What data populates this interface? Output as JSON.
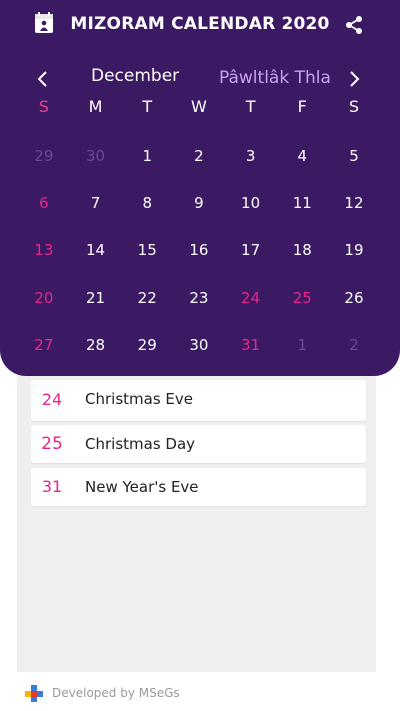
{
  "app": {
    "title": "MIZORAM CALENDAR 2020",
    "logo_icon": "calendar-figure-icon",
    "share_icon": "share-icon"
  },
  "calendar": {
    "month": "December",
    "month_mizo": "Pâwltlâk Thla",
    "weekdays": [
      "S",
      "M",
      "T",
      "W",
      "T",
      "F",
      "S"
    ],
    "weeks": [
      [
        {
          "d": "29",
          "s": "muted"
        },
        {
          "d": "30",
          "s": "muted"
        },
        {
          "d": "1",
          "s": "normal"
        },
        {
          "d": "2",
          "s": "normal"
        },
        {
          "d": "3",
          "s": "normal"
        },
        {
          "d": "4",
          "s": "normal"
        },
        {
          "d": "5",
          "s": "normal"
        }
      ],
      [
        {
          "d": "6",
          "s": "holiday"
        },
        {
          "d": "7",
          "s": "normal"
        },
        {
          "d": "8",
          "s": "normal"
        },
        {
          "d": "9",
          "s": "normal"
        },
        {
          "d": "10",
          "s": "normal"
        },
        {
          "d": "11",
          "s": "normal"
        },
        {
          "d": "12",
          "s": "normal"
        }
      ],
      [
        {
          "d": "13",
          "s": "holiday"
        },
        {
          "d": "14",
          "s": "normal"
        },
        {
          "d": "15",
          "s": "normal"
        },
        {
          "d": "16",
          "s": "normal"
        },
        {
          "d": "17",
          "s": "normal"
        },
        {
          "d": "18",
          "s": "normal"
        },
        {
          "d": "19",
          "s": "normal"
        }
      ],
      [
        {
          "d": "20",
          "s": "holiday"
        },
        {
          "d": "21",
          "s": "normal"
        },
        {
          "d": "22",
          "s": "normal"
        },
        {
          "d": "23",
          "s": "normal"
        },
        {
          "d": "24",
          "s": "holiday"
        },
        {
          "d": "25",
          "s": "holiday"
        },
        {
          "d": "26",
          "s": "normal"
        }
      ],
      [
        {
          "d": "27",
          "s": "holiday"
        },
        {
          "d": "28",
          "s": "normal"
        },
        {
          "d": "29",
          "s": "normal"
        },
        {
          "d": "30",
          "s": "normal"
        },
        {
          "d": "31",
          "s": "holiday"
        },
        {
          "d": "1",
          "s": "muted"
        },
        {
          "d": "2",
          "s": "muted"
        }
      ]
    ]
  },
  "events": [
    {
      "date": "24",
      "name": "Christmas Eve"
    },
    {
      "date": "25",
      "name": "Christmas Day"
    },
    {
      "date": "31",
      "name": "New Year's Eve"
    }
  ],
  "footer": {
    "text": "Developed by MSeGs"
  },
  "colors": {
    "header_bg": "#3c1a63",
    "holiday": "#e7268a",
    "muted": "#6a4a92",
    "mizo_month": "#c9a0ee"
  }
}
